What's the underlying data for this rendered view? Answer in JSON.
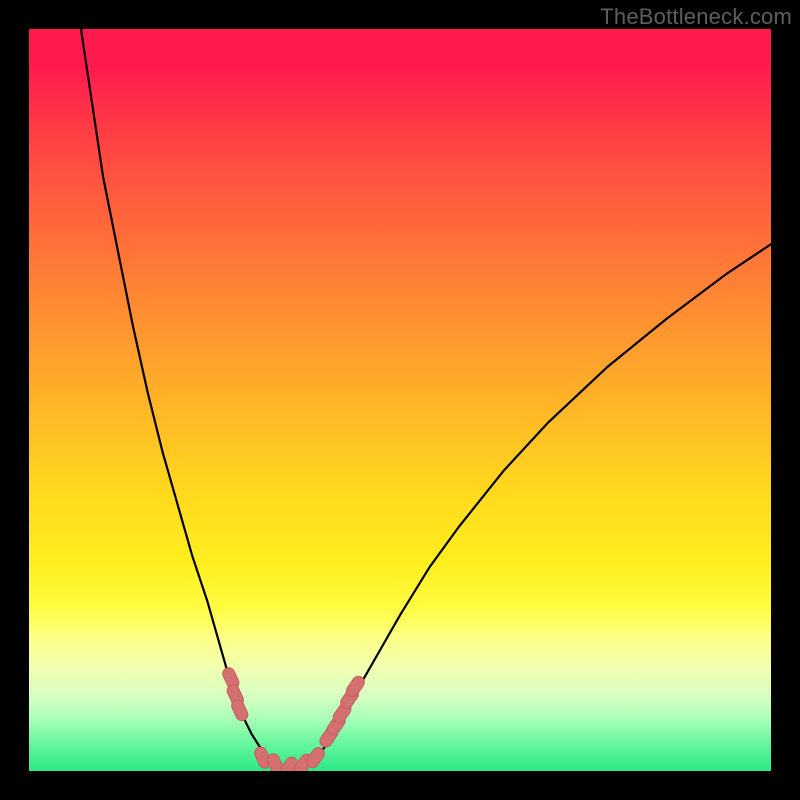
{
  "watermark": "TheBottleneck.com",
  "colors": {
    "background_frame": "#000000",
    "gradient_top": "#ff1a4e",
    "gradient_bottom": "#2ce885",
    "curve_stroke": "#000000",
    "marker_fill": "#d47170",
    "marker_stroke": "#c15f5e"
  },
  "chart_data": {
    "type": "line",
    "title": "",
    "xlabel": "",
    "ylabel": "",
    "xlim": [
      0,
      100
    ],
    "ylim": [
      0,
      100
    ],
    "grid": false,
    "legend": false,
    "series": [
      {
        "name": "bottleneck_curve",
        "note": "y≈100 at top (worst), y≈0 at bottom (best); x estimated from pixels",
        "x": [
          7.0,
          8.5,
          10.0,
          12.0,
          14.0,
          16.0,
          18.0,
          20.0,
          22.0,
          24.0,
          26.0,
          27.0,
          28.0,
          29.0,
          30.0,
          31.0,
          32.0,
          33.0,
          34.0,
          35.0,
          36.0,
          37.0,
          38.0,
          39.0,
          40.0,
          42.0,
          44.0,
          46.0,
          50.0,
          54.0,
          58.0,
          64.0,
          70.0,
          78.0,
          86.0,
          94.0,
          100.0
        ],
        "y": [
          100.0,
          90.0,
          80.0,
          70.0,
          60.0,
          51.0,
          43.0,
          36.0,
          29.0,
          23.0,
          16.0,
          12.5,
          9.5,
          7.0,
          5.0,
          3.4,
          2.2,
          1.3,
          0.7,
          0.5,
          0.5,
          0.7,
          1.3,
          2.2,
          3.4,
          6.8,
          10.5,
          14.0,
          21.0,
          27.5,
          33.0,
          40.5,
          47.0,
          54.5,
          61.0,
          67.0,
          71.0
        ]
      }
    ],
    "markers": [
      {
        "name": "left_cluster_top",
        "x": 27.2,
        "y": 12.5
      },
      {
        "name": "left_cluster_up",
        "x": 27.8,
        "y": 10.2
      },
      {
        "name": "left_cluster_low",
        "x": 28.4,
        "y": 8.2
      },
      {
        "name": "valley_left",
        "x": 31.5,
        "y": 1.8
      },
      {
        "name": "valley_mid_left",
        "x": 33.2,
        "y": 0.9
      },
      {
        "name": "valley_center",
        "x": 35.0,
        "y": 0.5
      },
      {
        "name": "valley_mid_right",
        "x": 37.0,
        "y": 0.9
      },
      {
        "name": "valley_right",
        "x": 38.6,
        "y": 1.8
      },
      {
        "name": "right_cluster_a",
        "x": 40.4,
        "y": 4.6
      },
      {
        "name": "right_cluster_b",
        "x": 41.4,
        "y": 6.2
      },
      {
        "name": "right_cluster_c",
        "x": 42.2,
        "y": 7.8
      },
      {
        "name": "right_cluster_d",
        "x": 43.2,
        "y": 9.8
      },
      {
        "name": "right_cluster_e",
        "x": 44.0,
        "y": 11.4
      }
    ]
  }
}
